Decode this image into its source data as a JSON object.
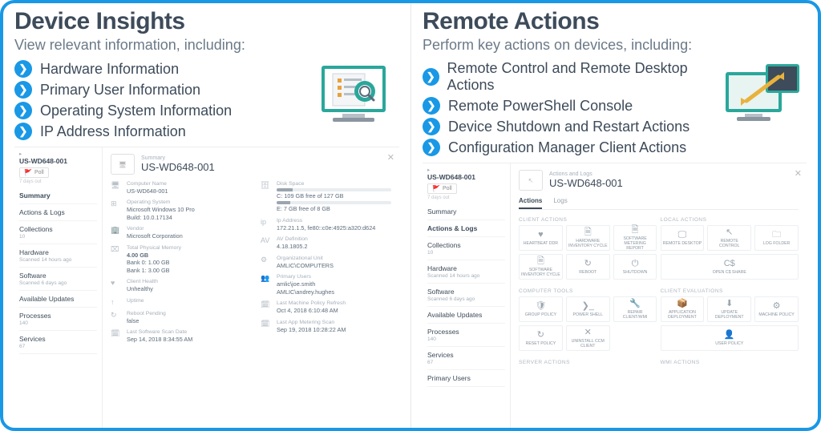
{
  "left": {
    "title": "Device Insights",
    "subtitle": "View relevant information, including:",
    "bullets": [
      "Hardware Information",
      "Primary User Information",
      "Operating System Information",
      "IP Address Information"
    ]
  },
  "right": {
    "title": "Remote Actions",
    "subtitle": "Perform key actions on devices, including:",
    "bullets": [
      "Remote Control and Remote Desktop Actions",
      "Remote PowerShell Console",
      "Device Shutdown and Restart Actions",
      "Configuration Manager Client Actions"
    ]
  },
  "device": {
    "name": "US-WD648-001",
    "badge": "Poll",
    "badge_hint": "7 days out"
  },
  "nav": {
    "summary": "Summary",
    "actions": "Actions & Logs",
    "collections": "Collections",
    "collections_hint": "10",
    "hardware": "Hardware",
    "hardware_hint": "Scanned 14 hours ago",
    "software": "Software",
    "software_hint": "Scanned 6 days ago",
    "updates": "Available Updates",
    "processes": "Processes",
    "processes_hint": "140",
    "services": "Services",
    "services_hint": "67",
    "primary_users": "Primary Users"
  },
  "summary": {
    "section_label": "Summary",
    "title": "US-WD648-001",
    "computer_name_l": "Computer Name",
    "computer_name": "US-WD648-001",
    "os_l": "Operating System",
    "os": "Microsoft Windows 10 Pro\nBuild: 10.0.17134",
    "vendor_l": "Vendor",
    "vendor": "Microsoft Corporation",
    "mem_l": "Total Physical Memory",
    "mem": "4.00 GB",
    "mem_banks": "Bank 0: 1.00 GB\nBank 1: 3.00 GB",
    "health_l": "Client Health",
    "health": "Unhealthy",
    "uptime_l": "Uptime",
    "reboot_l": "Reboot Pending",
    "reboot": "false",
    "sw_scan_l": "Last Software Scan Date",
    "sw_scan": "Sep 14, 2018 8:34:55 AM",
    "disk_l": "Disk Space",
    "disk_c": "C: 109 GB free of 127 GB",
    "disk_e": "E: 7 GB free of 8 GB",
    "ip_l": "Ip Address",
    "ip": "172.21.1.5, fe80::c0e:4925:a320:d624",
    "av_l": "AV Definition",
    "av": "4.18.1805.2",
    "ou_l": "Organizational Unit",
    "ou": "AMLIC\\COMPUTERS",
    "users_l": "Primary Users",
    "users": "amlic\\joe.smith\nAMLIC\\andrey.hughes",
    "policy_l": "Last Machine Policy Refresh",
    "policy": "Oct 4, 2018 6:10:48 AM",
    "meter_l": "Last App Metering Scan",
    "meter": "Sep 19, 2018 10:28:22 AM"
  },
  "actions_card": {
    "section_label": "Actions and Logs",
    "title": "US-WD648-001",
    "tab_actions": "Actions",
    "tab_logs": "Logs",
    "grp_client": "CLIENT ACTIONS",
    "grp_local": "LOCAL ACTIONS",
    "grp_tools": "COMPUTER TOOLS",
    "grp_eval": "CLIENT EVALUATIONS",
    "grp_server": "SERVER ACTIONS",
    "grp_wmi": "WMI ACTIONS",
    "t_heartbeat": "HEARTBEAT DDR",
    "t_hwinv": "HARDWARE INVENTORY CYCLE",
    "t_swmeter": "SOFTWARE METERING REPORT",
    "t_rdesktop": "REMOTE DESKTOP",
    "t_rcontrol": "REMOTE CONTROL",
    "t_logfolder": "LOG FOLDER",
    "t_swinv": "SOFTWARE INVENTORY CYCLE",
    "t_reboot": "REBOOT",
    "t_shutdown": "SHUTDOWN",
    "t_cshare": "OPEN C$ SHARE",
    "t_gpolicy": "GROUP POLICY",
    "t_pshell": "POWER SHELL",
    "t_repair": "REPAIR CLIENT/WMI",
    "t_appdep": "APPLICATION DEPLOYMENT",
    "t_upddep": "UPDATE DEPLOYMENT",
    "t_machpol": "MACHINE POLICY",
    "t_resetpol": "RESET POLICY",
    "t_uninstall": "UNINSTALL CCM CLIENT",
    "t_userpol": "USER POLICY"
  }
}
